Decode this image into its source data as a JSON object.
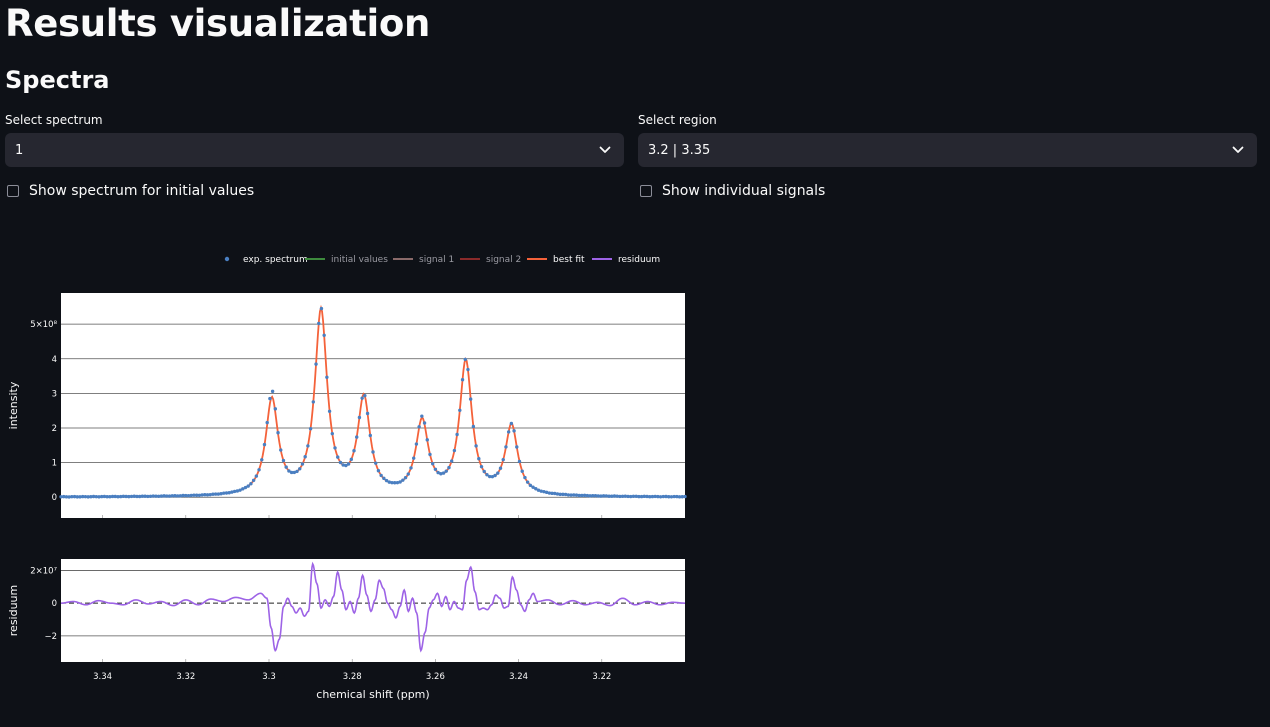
{
  "header": {
    "title": "Results visualization",
    "section": "Spectra"
  },
  "controls": {
    "spectrum": {
      "label": "Select spectrum",
      "value": "1"
    },
    "region": {
      "label": "Select region",
      "value": "3.2 | 3.35"
    },
    "checkbox_initial": {
      "label": "Show spectrum for initial values",
      "checked": false
    },
    "checkbox_signals": {
      "label": "Show individual signals",
      "checked": false
    }
  },
  "legend": [
    {
      "name": "exp. spectrum",
      "color": "#4a7fc1",
      "kind": "marker"
    },
    {
      "name": "initial values",
      "color": "#3d8a3d",
      "kind": "line"
    },
    {
      "name": "signal 1",
      "color": "#8a6a6a",
      "kind": "line"
    },
    {
      "name": "signal 2",
      "color": "#8a2a2a",
      "kind": "line"
    },
    {
      "name": "best fit",
      "color": "#f4623a",
      "kind": "line"
    },
    {
      "name": "residuum",
      "color": "#9d63e6",
      "kind": "line"
    }
  ],
  "chart_data": [
    {
      "type": "line",
      "ylabel": "intensity",
      "x_range": [
        3.35,
        3.2
      ],
      "ylim": [
        -60000000.0,
        590000000.0
      ],
      "y_ticks": [
        0,
        100000000.0,
        200000000.0,
        300000000.0,
        400000000.0,
        500000000.0
      ],
      "y_tick_labels": [
        "0",
        "1",
        "2",
        "3",
        "4",
        "5×10⁸"
      ],
      "grid": true,
      "series": [
        {
          "name": "exp. spectrum",
          "kind": "markers",
          "color": "#4a7fc1"
        },
        {
          "name": "best fit",
          "kind": "line",
          "color": "#f4623a"
        }
      ],
      "peaks": [
        {
          "x": 3.2993,
          "height": 275000000.0,
          "width": 0.0018
        },
        {
          "x": 3.2875,
          "height": 530000000.0,
          "width": 0.0018
        },
        {
          "x": 3.2772,
          "height": 275000000.0,
          "width": 0.0018
        },
        {
          "x": 3.2632,
          "height": 210000000.0,
          "width": 0.0018
        },
        {
          "x": 3.2527,
          "height": 385000000.0,
          "width": 0.0018
        },
        {
          "x": 3.2417,
          "height": 200000000.0,
          "width": 0.0018
        }
      ],
      "exp_deviations": [
        {
          "x": 3.2993,
          "y": 310000000.0
        },
        {
          "x": 3.2632,
          "y": 235000000.0
        }
      ]
    },
    {
      "type": "line",
      "xlabel": "chemical shift (ppm)",
      "ylabel": "residuum",
      "x_range": [
        3.35,
        3.2
      ],
      "ylim": [
        -36000000.0,
        27000000.0
      ],
      "y_ticks": [
        -20000000.0,
        0,
        20000000.0
      ],
      "y_tick_labels": [
        "−2",
        "0",
        "2×10⁷"
      ],
      "x_ticks": [
        3.34,
        3.32,
        3.3,
        3.28,
        3.26,
        3.24,
        3.22
      ],
      "x_tick_labels": [
        "3.34",
        "3.32",
        "3.3",
        "3.28",
        "3.26",
        "3.24",
        "3.22"
      ],
      "grid": true,
      "zero_line": "dashed",
      "series": [
        {
          "name": "residuum",
          "color": "#9d63e6",
          "x": [
            3.35,
            3.347,
            3.344,
            3.341,
            3.338,
            3.335,
            3.332,
            3.329,
            3.326,
            3.323,
            3.32,
            3.317,
            3.314,
            3.311,
            3.308,
            3.305,
            3.302,
            3.3005,
            3.2995,
            3.2985,
            3.2975,
            3.2965,
            3.2955,
            3.2945,
            3.2935,
            3.2925,
            3.2915,
            3.2905,
            3.2895,
            3.2885,
            3.2875,
            3.2865,
            3.2855,
            3.2845,
            3.2835,
            3.2825,
            3.2815,
            3.2805,
            3.2795,
            3.2785,
            3.2775,
            3.2765,
            3.2755,
            3.2745,
            3.2735,
            3.2725,
            3.2715,
            3.2705,
            3.2695,
            3.2685,
            3.2675,
            3.2665,
            3.2655,
            3.2645,
            3.2635,
            3.2625,
            3.2615,
            3.2605,
            3.2595,
            3.2585,
            3.2575,
            3.2565,
            3.2555,
            3.2545,
            3.2535,
            3.2525,
            3.2515,
            3.2505,
            3.2495,
            3.2485,
            3.2475,
            3.2465,
            3.2455,
            3.2445,
            3.2435,
            3.2425,
            3.2415,
            3.2405,
            3.2395,
            3.2385,
            3.2375,
            3.2365,
            3.2355,
            3.233,
            3.23,
            3.227,
            3.224,
            3.221,
            3.218,
            3.215,
            3.212,
            3.209,
            3.206,
            3.203,
            3.2
          ],
          "y": [
            0,
            1000000.0,
            -1000000.0,
            1500000.0,
            0,
            -1000000.0,
            2000000.0,
            -500000.0,
            1000000.0,
            -1500000.0,
            2000000.0,
            -1000000.0,
            2500000.0,
            1000000.0,
            3500000.0,
            2000000.0,
            6000000.0,
            3000000.0,
            -15000000.0,
            -29000000.0,
            -22000000.0,
            -2000000.0,
            3000000.0,
            -2000000.0,
            -6000000.0,
            -3000000.0,
            -8000000.0,
            -5000000.0,
            24000000.0,
            12000000.0,
            -3000000.0,
            2000000.0,
            -2000000.0,
            4000000.0,
            19000000.0,
            8000000.0,
            -4000000.0,
            1000000.0,
            -6000000.0,
            3000000.0,
            17000000.0,
            5000000.0,
            -5000000.0,
            2000000.0,
            14000000.0,
            9000000.0,
            0,
            -4000000.0,
            -9000000.0,
            -2000000.0,
            8000000.0,
            -5000000.0,
            3000000.0,
            -6000000.0,
            -29000000.0,
            -18000000.0,
            -3000000.0,
            2000000.0,
            6000000.0,
            -2000000.0,
            4000000.0,
            -4000000.0,
            1000000.0,
            -3000000.0,
            -4000000.0,
            14000000.0,
            22000000.0,
            7000000.0,
            -4000000.0,
            -3000000.0,
            -4000000.0,
            -1000000.0,
            5000000.0,
            3000000.0,
            -3000000.0,
            -2000000.0,
            16000000.0,
            8000000.0,
            -1000000.0,
            -5000000.0,
            2000000.0,
            6000000.0,
            1000000.0,
            2000000.0,
            -1000000.0,
            1500000.0,
            -1000000.0,
            500000.0,
            -1500000.0,
            3000000.0,
            -1000000.0,
            1000000.0,
            -1000000.0,
            500000.0,
            0
          ]
        }
      ]
    }
  ]
}
